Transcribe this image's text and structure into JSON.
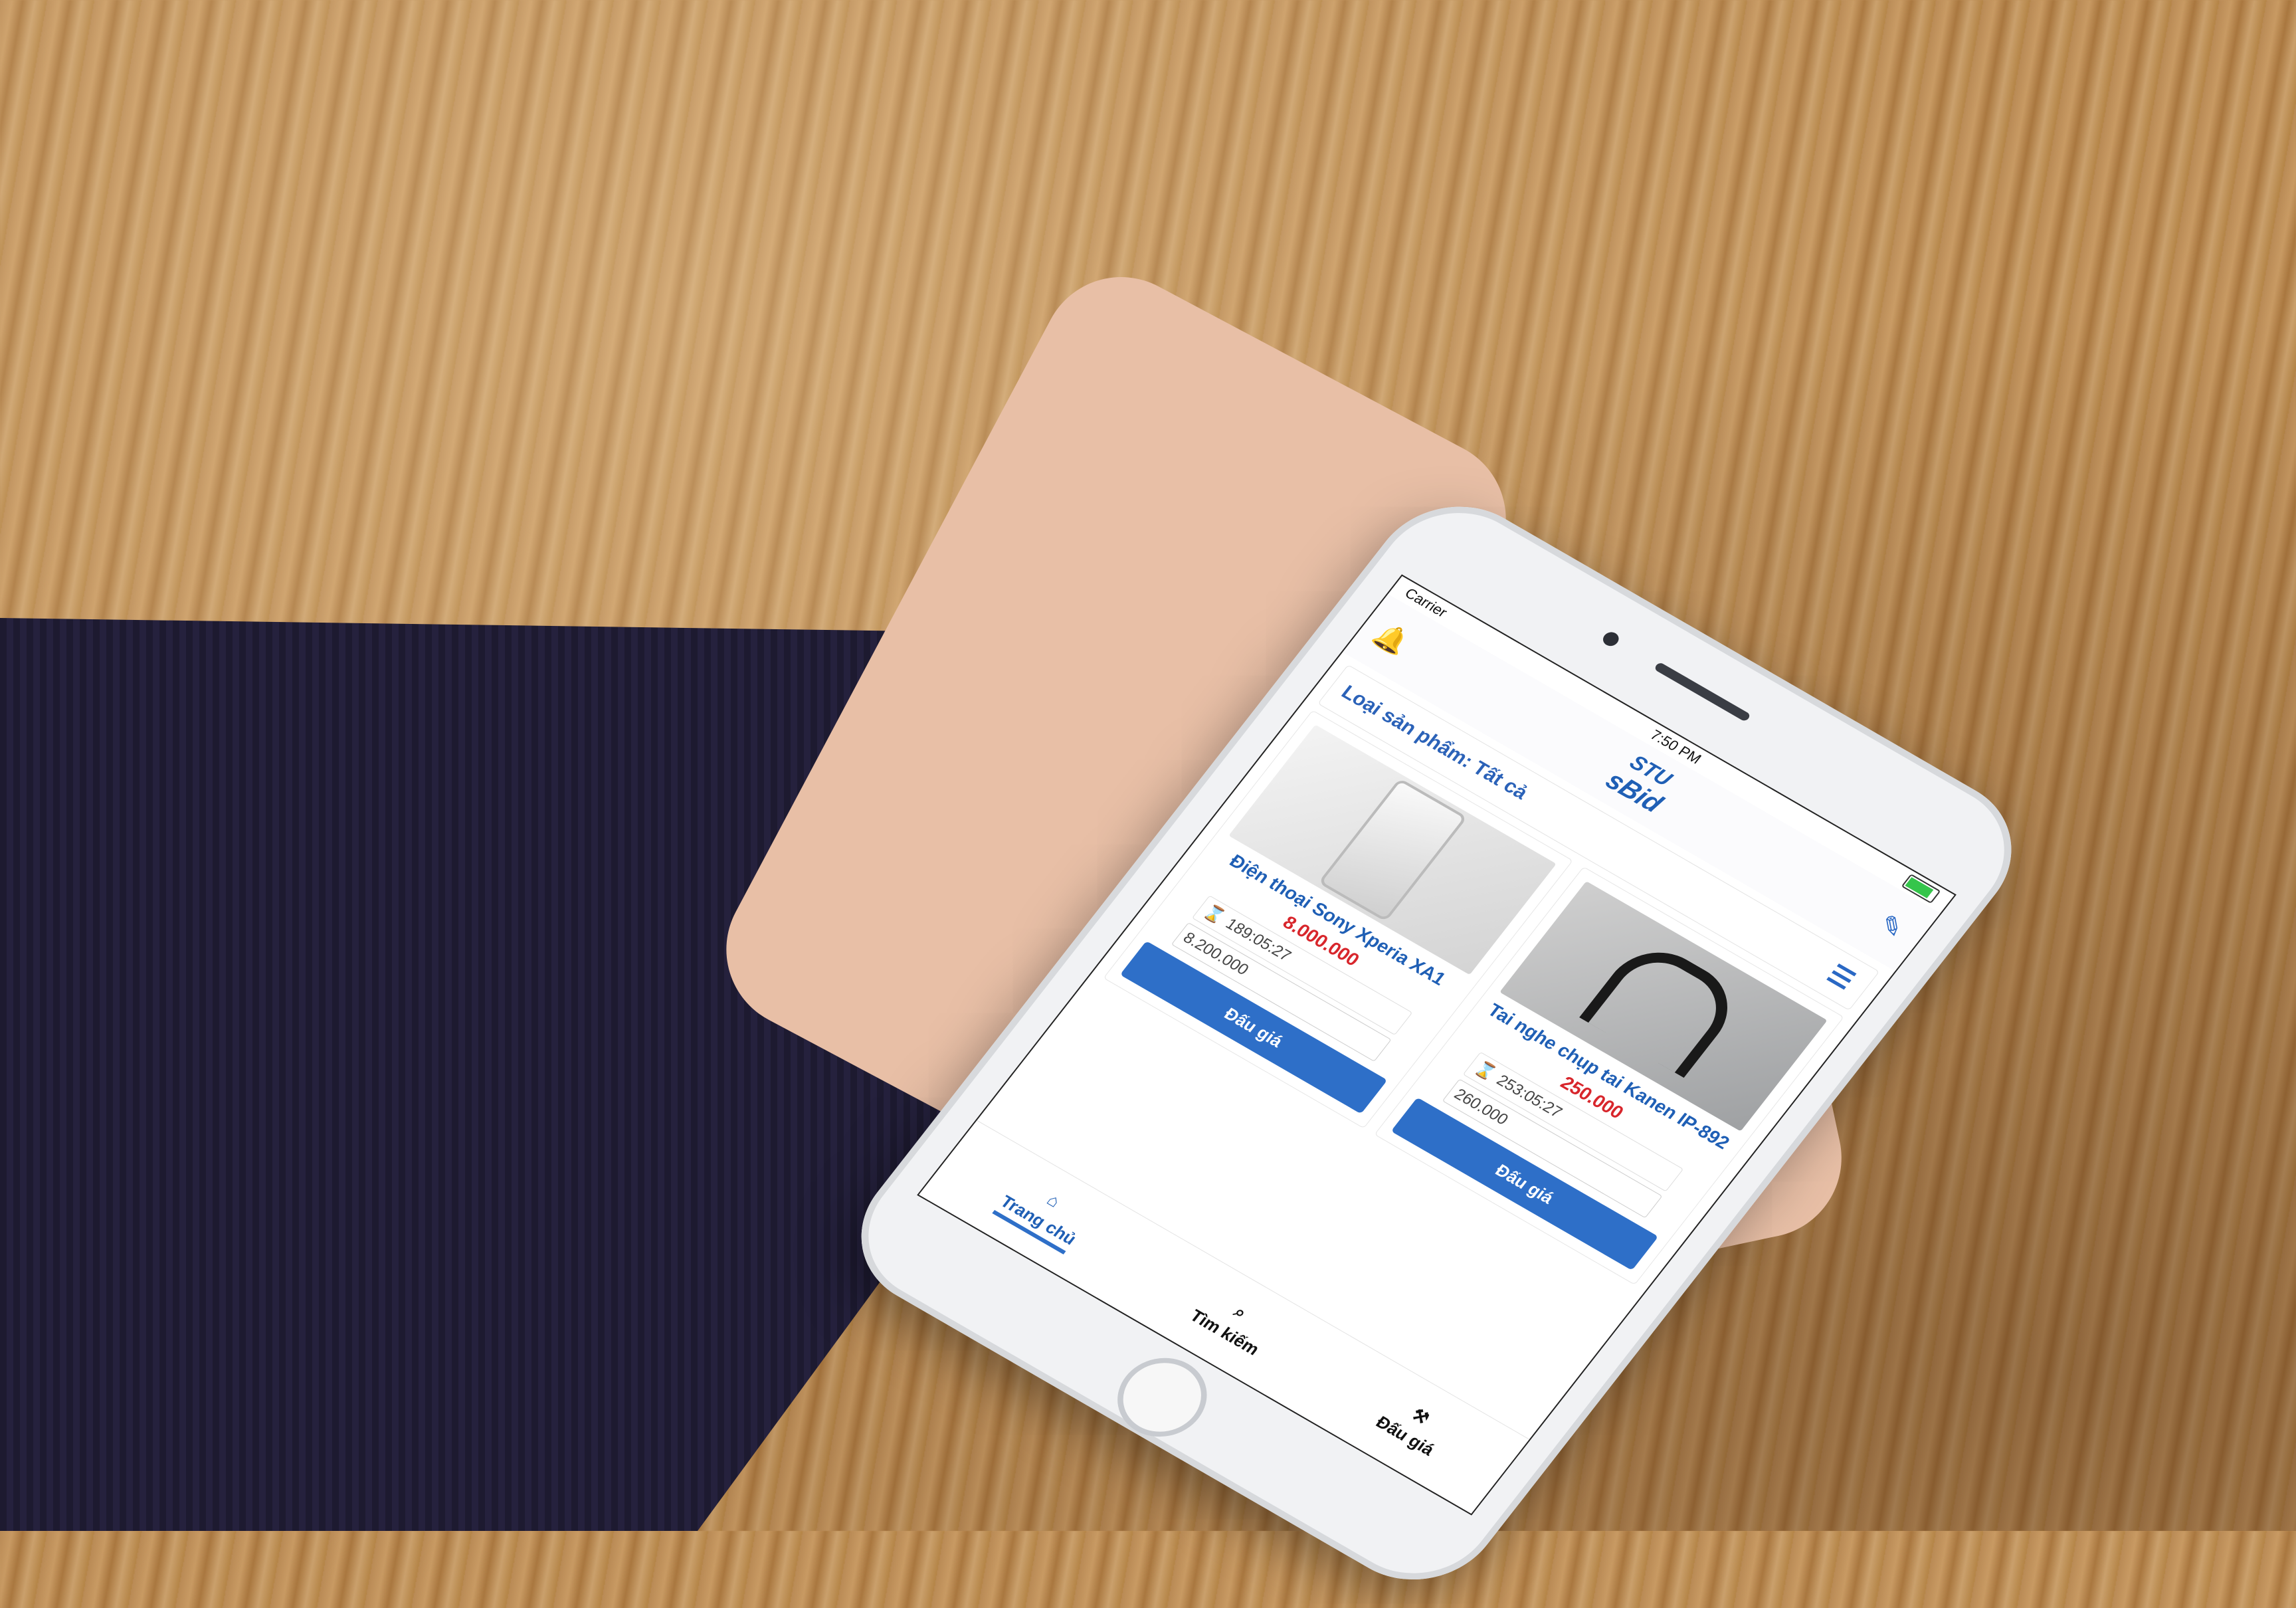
{
  "statusbar": {
    "carrier": "Carrier",
    "time": "7:50 PM"
  },
  "header": {
    "logo_top": "STU",
    "logo_bottom": "sBid"
  },
  "filter": {
    "label": "Loại sản phẩm: Tất cả"
  },
  "products": [
    {
      "name": "Điện thoại Sony Xperia XA1",
      "price": "8.000.000",
      "timer": "189:05:27",
      "bid_value": "8.200.000",
      "button": "Đấu giá"
    },
    {
      "name": "Tai nghe chụp tai Kanen IP-892",
      "price": "250.000",
      "timer": "253:05:27",
      "bid_value": "260.000",
      "button": "Đấu giá"
    }
  ],
  "tabs": [
    {
      "label": "Trang chủ"
    },
    {
      "label": "Tìm kiếm"
    },
    {
      "label": "Đấu giá"
    }
  ],
  "colors": {
    "accent": "#2e6fc8",
    "price": "#d8262c"
  }
}
